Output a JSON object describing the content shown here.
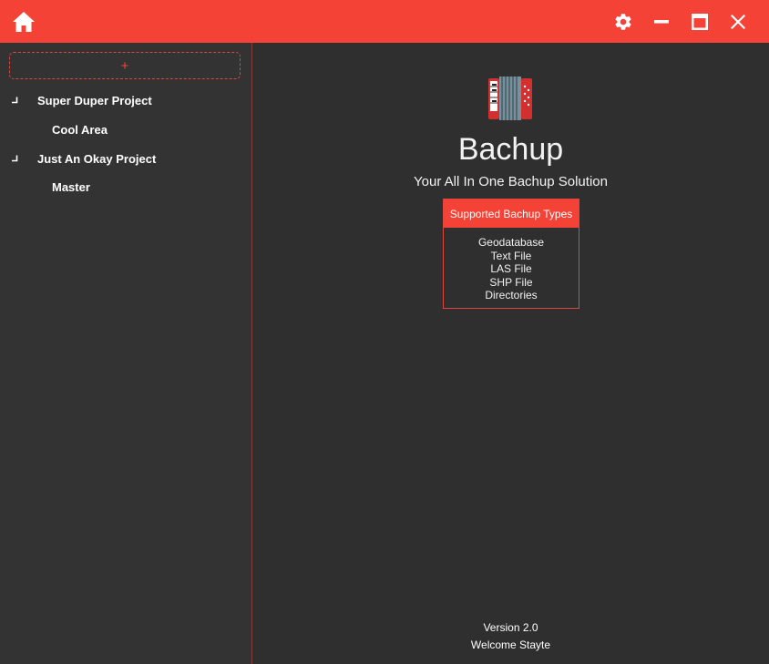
{
  "colors": {
    "accent": "#f44336",
    "background": "#2f2f2f",
    "sidebar": "#333333"
  },
  "titlebar": {
    "home_icon": "home-icon",
    "settings_icon": "gear-icon",
    "minimize_icon": "minimize-icon",
    "maximize_icon": "maximize-icon",
    "close_icon": "close-icon"
  },
  "sidebar": {
    "add_label": "+",
    "projects": [
      {
        "name": "Super Duper Project",
        "children": [
          "Cool Area"
        ]
      },
      {
        "name": "Just An Okay Project",
        "children": [
          "Master"
        ]
      }
    ]
  },
  "main": {
    "logo_icon": "accordion-icon",
    "app_name": "Bachup",
    "tagline": "Your All In One Bachup Solution",
    "types_header": "Supported Bachup Types",
    "types": [
      "Geodatabase",
      "Text File",
      "LAS File",
      "SHP File",
      "Directories"
    ],
    "version": "Version 2.0",
    "welcome": "Welcome Stayte"
  }
}
